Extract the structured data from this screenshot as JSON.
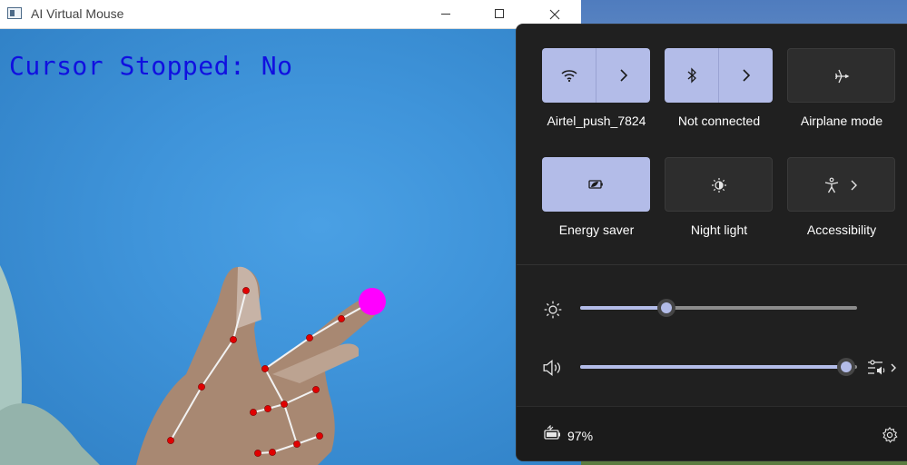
{
  "window": {
    "title": "AI Virtual Mouse"
  },
  "overlay": {
    "cursor_status": "Cursor Stopped: No"
  },
  "quick_settings": {
    "tiles": [
      {
        "label": "Airtel_push_7824",
        "icon": "wifi-icon",
        "active": true
      },
      {
        "label": "Not connected",
        "icon": "bluetooth-icon",
        "active": true
      },
      {
        "label": "Airplane mode",
        "icon": "airplane-icon",
        "active": false
      },
      {
        "label": "Energy saver",
        "icon": "energy-saver-icon",
        "active": true
      },
      {
        "label": "Night light",
        "icon": "night-light-icon",
        "active": false
      },
      {
        "label": "Accessibility",
        "icon": "accessibility-icon",
        "active": false
      }
    ],
    "brightness": {
      "icon": "brightness-icon",
      "level": 0.31
    },
    "volume": {
      "icon": "volume-icon",
      "level": 0.96
    },
    "battery": {
      "icon": "battery-icon",
      "text": "97%"
    }
  },
  "colors": {
    "accent": "#b3bce8",
    "panel": "#202020",
    "landmark": "#e00000",
    "pointer": "#ff00ff",
    "status_text": "#1010e0"
  }
}
